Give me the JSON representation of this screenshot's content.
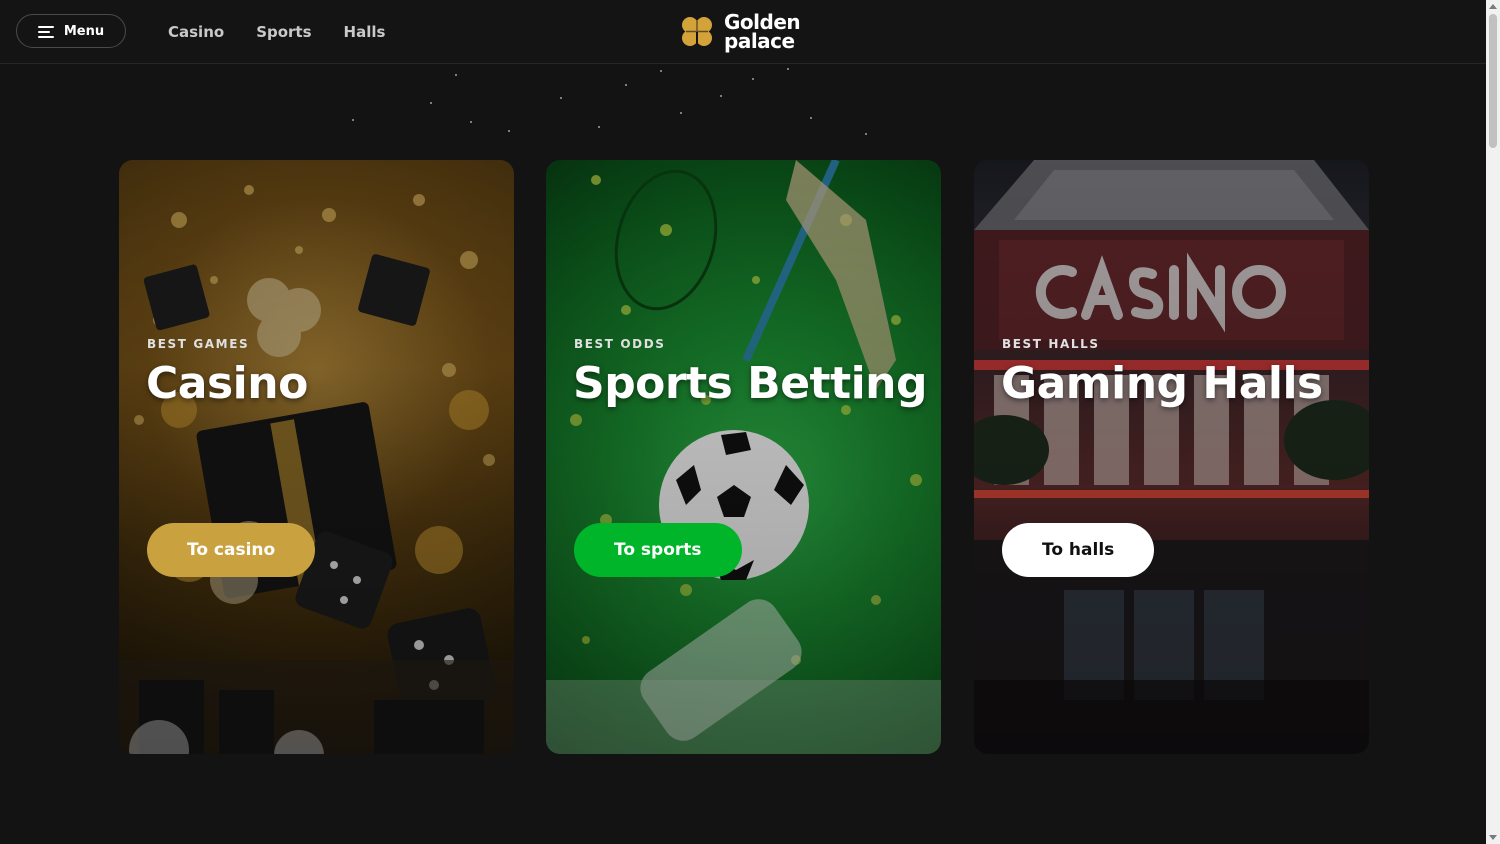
{
  "header": {
    "menu_label": "Menu",
    "nav": [
      "Casino",
      "Sports",
      "Halls"
    ],
    "logo_line1": "Golden",
    "logo_line2": "palace"
  },
  "cards": [
    {
      "eyebrow": "BEST GAMES",
      "title": "Casino",
      "cta": "To casino"
    },
    {
      "eyebrow": "BEST ODDS",
      "title": "Sports Betting",
      "cta": "To sports"
    },
    {
      "eyebrow": "BEST HALLS",
      "title": "Gaming Halls",
      "cta": "To halls"
    }
  ],
  "colors": {
    "background": "#131313",
    "casino_accent": "#c9a13f",
    "sports_accent": "#00b52a",
    "halls_button": "#ffffff",
    "logo_gold": "#d3a33a"
  },
  "icons": [
    "menu-icon",
    "clover-logo-icon"
  ]
}
